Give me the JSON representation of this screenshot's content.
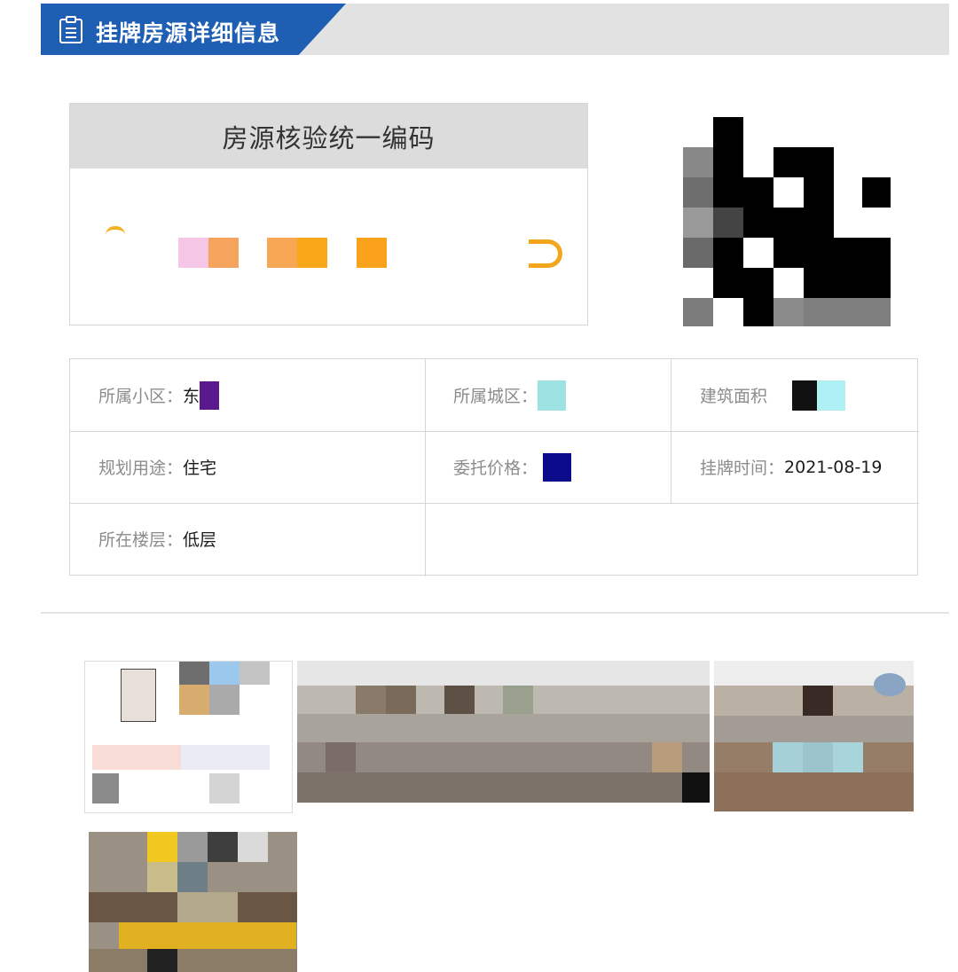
{
  "header": {
    "title": "挂牌房源详细信息",
    "icon": "document-list-icon"
  },
  "code_box": {
    "title": "房源核验统一编码",
    "value_note": "",
    "colors": [
      "#f4c6e7",
      "#f8a85e",
      "#f8a85e",
      "#f9a825",
      "#f9a825"
    ]
  },
  "qr_code": {
    "icon": "qr-code-icon"
  },
  "info": {
    "community": {
      "label": "所属小区：",
      "value": "东"
    },
    "district": {
      "label": "所属城区：",
      "value": ""
    },
    "area": {
      "label": "建筑面积",
      "value": ""
    },
    "usage": {
      "label": "规划用途：",
      "value": "住宅"
    },
    "price": {
      "label": "委托价格：",
      "value": ""
    },
    "listing_time": {
      "label": "挂牌时间：",
      "value": "2021-08-19"
    },
    "floor": {
      "label": "所在楼层：",
      "value": "低层"
    }
  },
  "photos": {
    "count": 4
  }
}
